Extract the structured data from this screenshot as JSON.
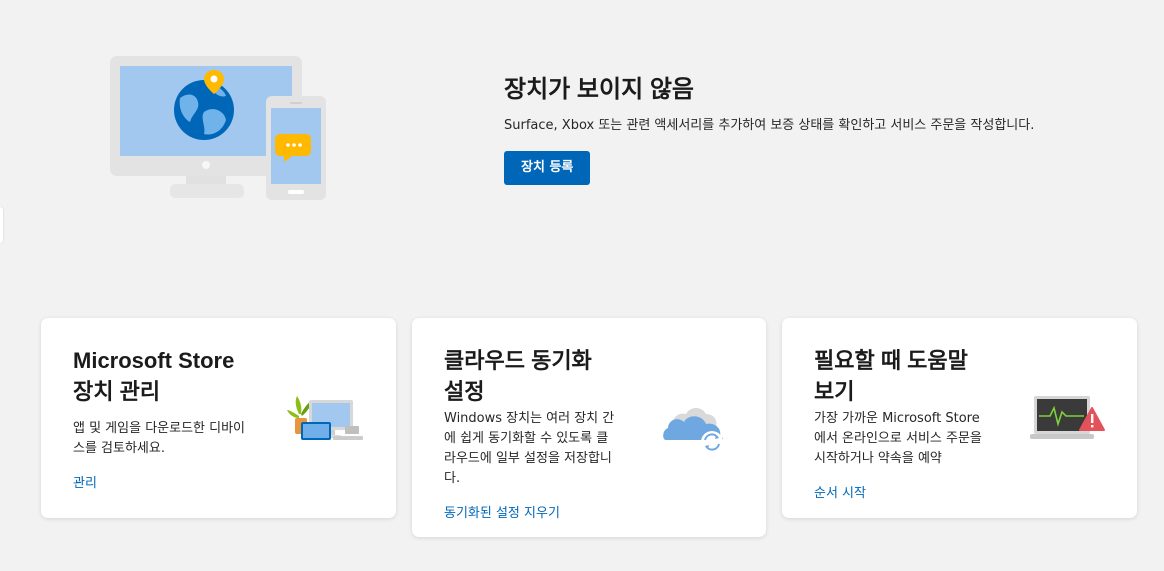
{
  "hero": {
    "title": "장치가 보이지 않음",
    "description": "Surface, Xbox 또는 관련 액세서리를 추가하여 보증 상태를 확인하고 서비스 주문을 작성합니다.",
    "button_label": "장치 등록"
  },
  "cards": [
    {
      "title_line1": "Microsoft Store",
      "title_line2": "장치 관리",
      "description": "앱 및 게임을 다운로드한 디바이스를 검토하세요.",
      "link": "관리",
      "icon": "devices-illustration-icon"
    },
    {
      "title_line1": "클라우드 동기화",
      "title_line2": "설정",
      "description": "Windows 장치는 여러 장치 간에 쉽게 동기화할 수 있도록 클라우드에 일부 설정을 저장합니다.",
      "link": "동기화된 설정 지우기",
      "icon": "cloud-sync-icon"
    },
    {
      "title_line1": "필요할 때 도움말",
      "title_line2": "보기",
      "description": "가장 가까운 Microsoft Store에서 온라인으로 서비스 주문을 시작하거나 약속을 예약",
      "link": "순서 시작",
      "icon": "laptop-warning-icon"
    }
  ],
  "colors": {
    "accent": "#0067b8",
    "background": "#f2f2f2",
    "card": "#ffffff"
  }
}
